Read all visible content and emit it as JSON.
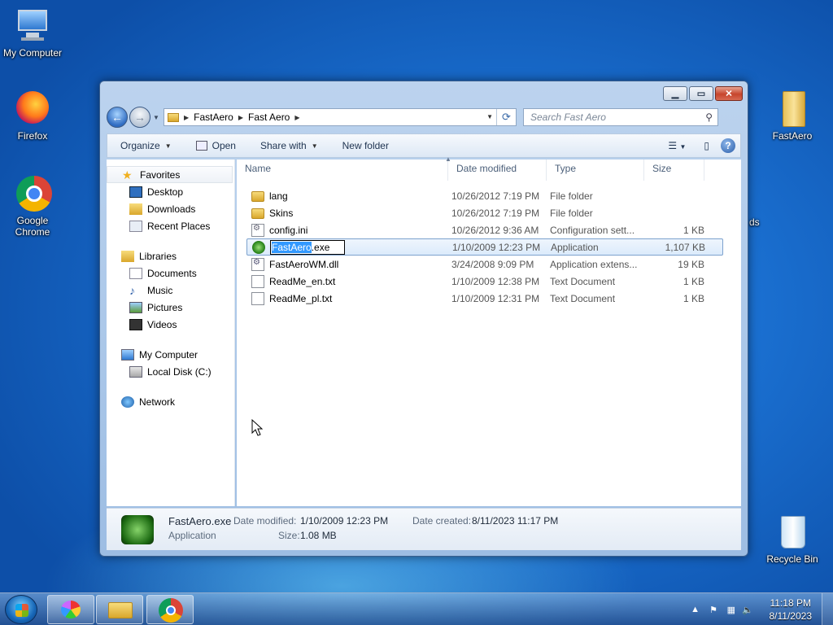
{
  "desktop": {
    "icons": {
      "my_computer": "My Computer",
      "firefox": "Firefox",
      "chrome": "Google Chrome",
      "fastaero": "FastAero",
      "recycle_bin": "Recycle Bin",
      "partial_label": "ds"
    }
  },
  "window": {
    "address": {
      "seg1": "FastAero",
      "seg2": "Fast Aero"
    },
    "search_placeholder": "Search Fast Aero",
    "toolbar": {
      "organize": "Organize",
      "open": "Open",
      "share_with": "Share with",
      "new_folder": "New folder"
    },
    "nav": {
      "favorites": "Favorites",
      "desktop": "Desktop",
      "downloads": "Downloads",
      "recent_places": "Recent Places",
      "libraries": "Libraries",
      "documents": "Documents",
      "music": "Music",
      "pictures": "Pictures",
      "videos": "Videos",
      "my_computer": "My Computer",
      "local_disk": "Local Disk (C:)",
      "network": "Network"
    },
    "columns": {
      "name": "Name",
      "date": "Date modified",
      "type": "Type",
      "size": "Size"
    },
    "files": [
      {
        "name": "lang",
        "date": "10/26/2012 7:19 PM",
        "type": "File folder",
        "size": ""
      },
      {
        "name": "Skins",
        "date": "10/26/2012 7:19 PM",
        "type": "File folder",
        "size": ""
      },
      {
        "name": "config.ini",
        "date": "10/26/2012 9:36 AM",
        "type": "Configuration sett...",
        "size": "1 KB"
      },
      {
        "name_sel": "FastAero",
        "name_rest": ".exe",
        "date": "1/10/2009 12:23 PM",
        "type": "Application",
        "size": "1,107 KB"
      },
      {
        "name": "FastAeroWM.dll",
        "date": "3/24/2008 9:09 PM",
        "type": "Application extens...",
        "size": "19 KB"
      },
      {
        "name": "ReadMe_en.txt",
        "date": "1/10/2009 12:38 PM",
        "type": "Text Document",
        "size": "1 KB"
      },
      {
        "name": "ReadMe_pl.txt",
        "date": "1/10/2009 12:31 PM",
        "type": "Text Document",
        "size": "1 KB"
      }
    ],
    "details": {
      "filename": "FastAero.exe",
      "type": "Application",
      "date_modified_label": "Date modified:",
      "date_modified": "1/10/2009 12:23 PM",
      "date_created_label": "Date created:",
      "date_created": "8/11/2023 11:17 PM",
      "size_label": "Size:",
      "size": "1.08 MB"
    }
  },
  "taskbar": {
    "time": "11:18 PM",
    "date": "8/11/2023"
  }
}
